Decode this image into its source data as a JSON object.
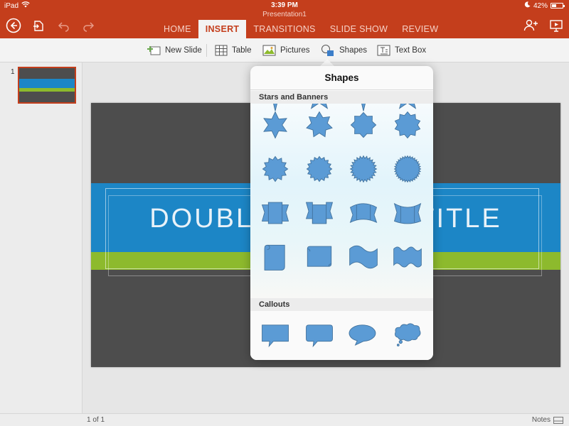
{
  "status": {
    "device": "iPad",
    "time": "3:39 PM",
    "battery": "42%",
    "battery_level": 0.42
  },
  "document": {
    "title": "Presentation1"
  },
  "tabs": [
    {
      "label": "HOME",
      "active": false
    },
    {
      "label": "INSERT",
      "active": true
    },
    {
      "label": "TRANSITIONS",
      "active": false
    },
    {
      "label": "SLIDE SHOW",
      "active": false
    },
    {
      "label": "REVIEW",
      "active": false
    }
  ],
  "ribbon": {
    "new_slide": "New Slide",
    "table": "Table",
    "pictures": "Pictures",
    "shapes": "Shapes",
    "text_box": "Text Box"
  },
  "thumbnails": [
    {
      "number": "1"
    }
  ],
  "slide": {
    "title": "DOUBLE BANDED TITLE"
  },
  "popover": {
    "title": "Shapes",
    "sections": {
      "stars": {
        "label": "Stars and Banners",
        "shapes": [
          "star-4-point-icon",
          "star-5-point-icon",
          "star-6-point-icon",
          "star-7-point-icon",
          "star-8-point-icon",
          "star-10-point-icon",
          "star-12-point-icon",
          "star-16-point-icon",
          "star-24-point-icon",
          "star-32-point-icon",
          "ribbon-up-icon",
          "ribbon-down-icon",
          "curved-ribbon-up-icon",
          "curved-ribbon-down-icon",
          "vertical-scroll-icon",
          "horizontal-scroll-icon",
          "wave-icon",
          "double-wave-icon"
        ]
      },
      "callouts": {
        "label": "Callouts",
        "shapes": [
          "rectangular-callout-icon",
          "rounded-rectangular-callout-icon",
          "oval-callout-icon",
          "cloud-callout-icon"
        ]
      }
    }
  },
  "footer": {
    "page": "1 of 1",
    "notes": "Notes"
  },
  "colors": {
    "accent": "#c43e1c",
    "shape_fill": "#5b9bd5",
    "shape_stroke": "#41719c",
    "slide_dark": "#4d4d4d",
    "band_blue": "#1c86c6",
    "band_green": "#8dba2d"
  }
}
